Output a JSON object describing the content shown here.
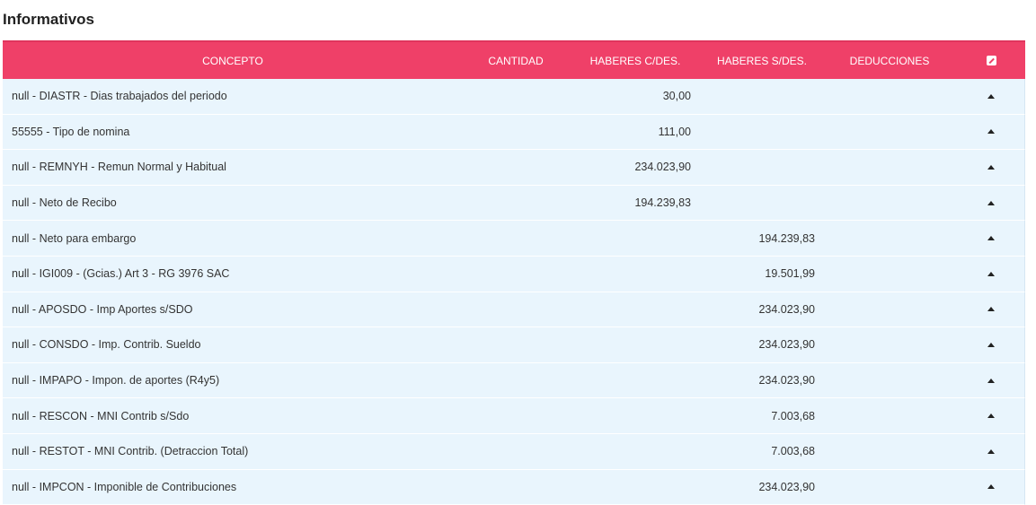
{
  "section": {
    "title": "Informativos"
  },
  "table": {
    "headers": {
      "concepto": "CONCEPTO",
      "cantidad": "CANTIDAD",
      "haberes_cdes": "HABERES C/DES.",
      "haberes_sdes": "HABERES S/DES.",
      "deducciones": "DEDUCCIONES"
    },
    "rows": [
      {
        "concepto": "null - DIASTR - Dias trabajados del periodo",
        "cantidad": "",
        "haberes_cdes": "30,00",
        "haberes_sdes": "",
        "deducciones": ""
      },
      {
        "concepto": "55555 - Tipo de nomina",
        "cantidad": "",
        "haberes_cdes": "111,00",
        "haberes_sdes": "",
        "deducciones": ""
      },
      {
        "concepto": "null - REMNYH - Remun Normal y Habitual",
        "cantidad": "",
        "haberes_cdes": "234.023,90",
        "haberes_sdes": "",
        "deducciones": ""
      },
      {
        "concepto": "null - Neto de Recibo",
        "cantidad": "",
        "haberes_cdes": "194.239,83",
        "haberes_sdes": "",
        "deducciones": ""
      },
      {
        "concepto": "null - Neto para embargo",
        "cantidad": "",
        "haberes_cdes": "",
        "haberes_sdes": "194.239,83",
        "deducciones": ""
      },
      {
        "concepto": "null - IGI009 - (Gcias.) Art 3 - RG 3976 SAC",
        "cantidad": "",
        "haberes_cdes": "",
        "haberes_sdes": "19.501,99",
        "deducciones": ""
      },
      {
        "concepto": "null - APOSDO - Imp Aportes s/SDO",
        "cantidad": "",
        "haberes_cdes": "",
        "haberes_sdes": "234.023,90",
        "deducciones": ""
      },
      {
        "concepto": "null - CONSDO - Imp. Contrib. Sueldo",
        "cantidad": "",
        "haberes_cdes": "",
        "haberes_sdes": "234.023,90",
        "deducciones": ""
      },
      {
        "concepto": "null - IMPAPO - Impon. de aportes (R4y5)",
        "cantidad": "",
        "haberes_cdes": "",
        "haberes_sdes": "234.023,90",
        "deducciones": ""
      },
      {
        "concepto": "null - RESCON - MNI Contrib s/Sdo",
        "cantidad": "",
        "haberes_cdes": "",
        "haberes_sdes": "7.003,68",
        "deducciones": ""
      },
      {
        "concepto": "null - RESTOT - MNI Contrib. (Detraccion Total)",
        "cantidad": "",
        "haberes_cdes": "",
        "haberes_sdes": "7.003,68",
        "deducciones": ""
      },
      {
        "concepto": "null - IMPCON - Imponible de Contribuciones",
        "cantidad": "",
        "haberes_cdes": "",
        "haberes_sdes": "234.023,90",
        "deducciones": ""
      }
    ]
  },
  "icons": {
    "header_action": "edit-icon",
    "row_action": "caret-up-icon"
  },
  "colors": {
    "header_bg": "#ef4068",
    "row_bg": "#e9f5fd"
  }
}
